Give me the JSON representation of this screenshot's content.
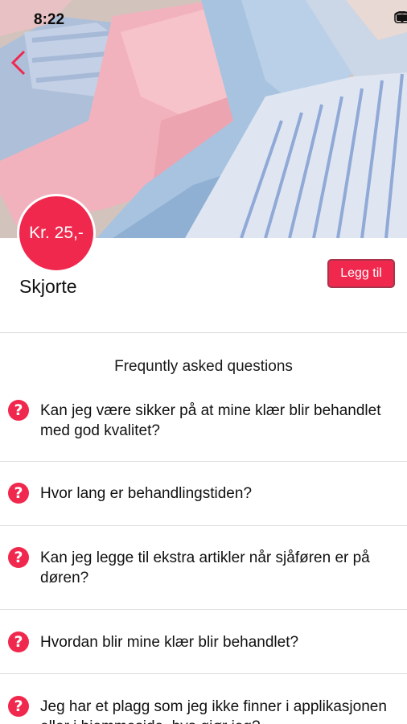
{
  "status_bar": {
    "time": "8:22"
  },
  "product": {
    "price": "Kr. 25,-",
    "title": "Skjorte",
    "add_label": "Legg til"
  },
  "faq": {
    "heading": "Frequntly asked questions",
    "items": [
      {
        "question": "Kan jeg være sikker på at mine klær blir behandlet med god kvalitet?"
      },
      {
        "question": "Hvor lang er behandlingstiden?"
      },
      {
        "question": "Kan jeg legge til ekstra artikler når sjåføren er på døren?"
      },
      {
        "question": "Hvordan blir mine klær blir behandlet?"
      },
      {
        "question": "Jeg har et plagg som jeg ikke finner i applikasjonen eller i hjemmeside, hva gjør jeg?"
      }
    ]
  },
  "colors": {
    "accent": "#f0284d",
    "divider": "#dcdcdc"
  },
  "icons": [
    "back-chevron-icon",
    "wifi-icon",
    "battery-icon",
    "question-icon"
  ]
}
